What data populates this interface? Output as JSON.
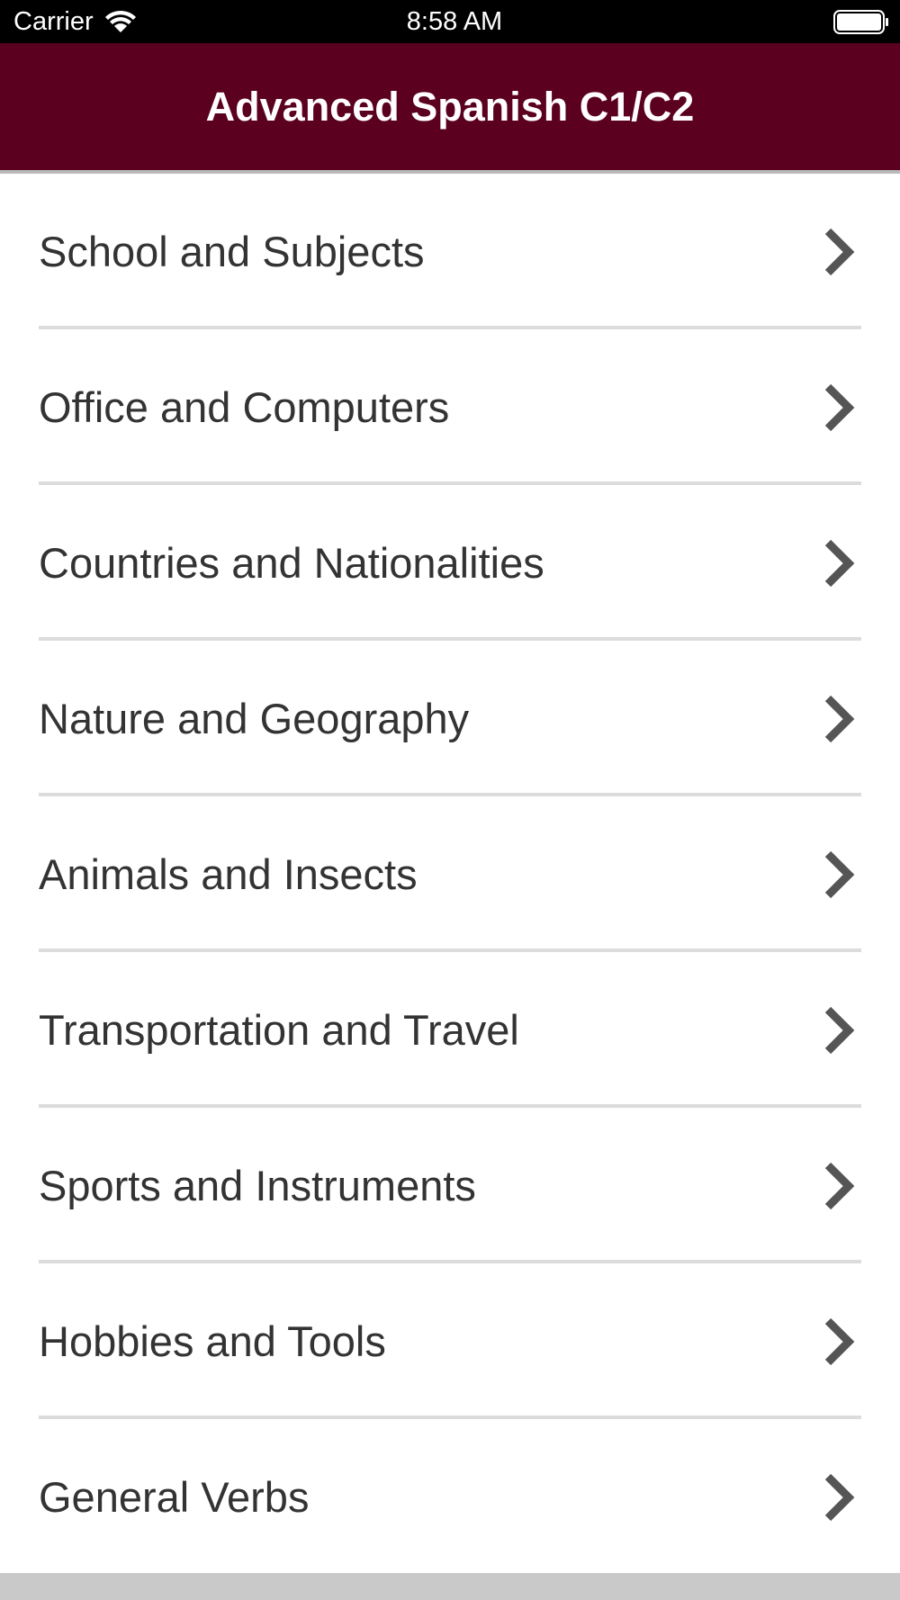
{
  "status_bar": {
    "carrier": "Carrier",
    "time": "8:58 AM",
    "wifi_icon": "wifi-icon",
    "battery_icon": "battery-full-icon"
  },
  "nav": {
    "title": "Advanced Spanish C1/C2",
    "background_color": "#5c0020"
  },
  "list": {
    "items": [
      {
        "label": "School and Subjects",
        "icon": "chevron-right-icon"
      },
      {
        "label": "Office and Computers",
        "icon": "chevron-right-icon"
      },
      {
        "label": "Countries and Nationalities",
        "icon": "chevron-right-icon"
      },
      {
        "label": "Nature and Geography",
        "icon": "chevron-right-icon"
      },
      {
        "label": "Animals and Insects",
        "icon": "chevron-right-icon"
      },
      {
        "label": "Transportation and Travel",
        "icon": "chevron-right-icon"
      },
      {
        "label": "Sports and Instruments",
        "icon": "chevron-right-icon"
      },
      {
        "label": "Hobbies and Tools",
        "icon": "chevron-right-icon"
      },
      {
        "label": "General Verbs",
        "icon": "chevron-right-icon"
      }
    ]
  }
}
